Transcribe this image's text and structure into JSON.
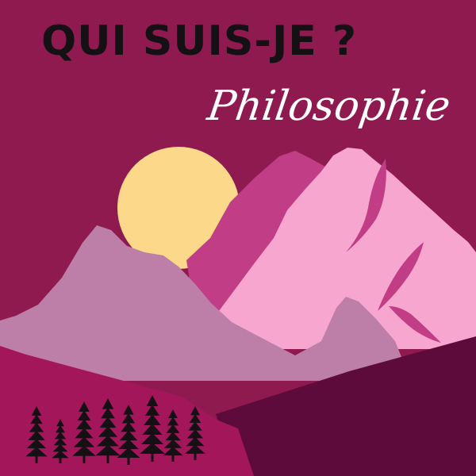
{
  "header": {
    "title": "QUI SUIS-JE ?",
    "subtitle": "Philosophie"
  },
  "colors": {
    "background": "#8e1a4f",
    "sun": "#fcd98a",
    "mountain_light_pink": "#f7a6d0",
    "mountain_magenta": "#c13d86",
    "mountain_dusty": "#bd7fa8",
    "ground_magenta": "#a3175a",
    "ground_dark": "#5c0b3a",
    "trees": "#141014"
  },
  "icons": {
    "trees": "pine-tree-icon"
  }
}
